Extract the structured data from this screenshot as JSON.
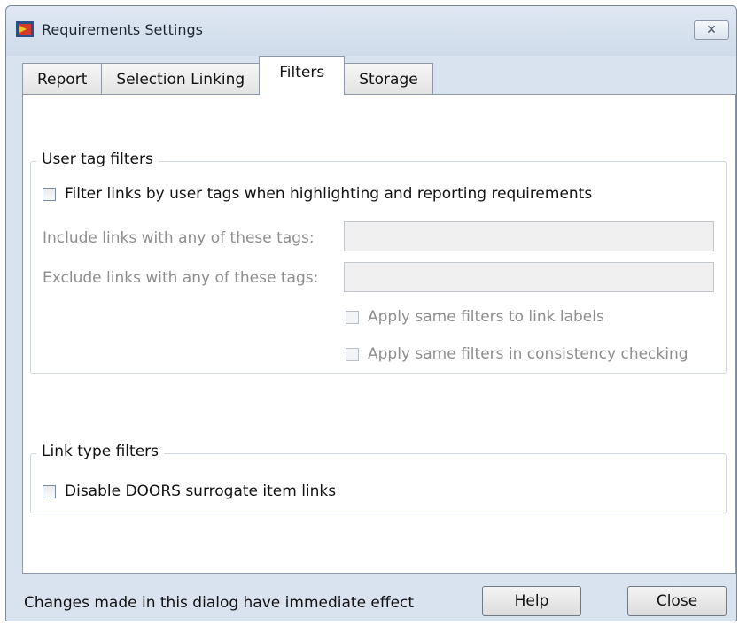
{
  "window": {
    "title": "Requirements Settings"
  },
  "tabs": [
    {
      "label": "Report"
    },
    {
      "label": "Selection Linking"
    },
    {
      "label": "Filters",
      "active": true
    },
    {
      "label": "Storage"
    }
  ],
  "user_tag_filters": {
    "title": "User tag filters",
    "filter_checkbox_label": "Filter links by user tags when highlighting and reporting requirements",
    "include_label": "Include links with any of these tags:",
    "include_value": "",
    "exclude_label": "Exclude links with any of these tags:",
    "exclude_value": "",
    "apply_labels_label": "Apply same filters to link labels",
    "apply_consistency_label": "Apply same filters in consistency checking"
  },
  "link_type_filters": {
    "title": "Link type filters",
    "disable_doors_label": "Disable DOORS surrogate item links"
  },
  "footer": {
    "message": "Changes made in this dialog have immediate effect",
    "help_label": "Help",
    "close_label": "Close"
  }
}
